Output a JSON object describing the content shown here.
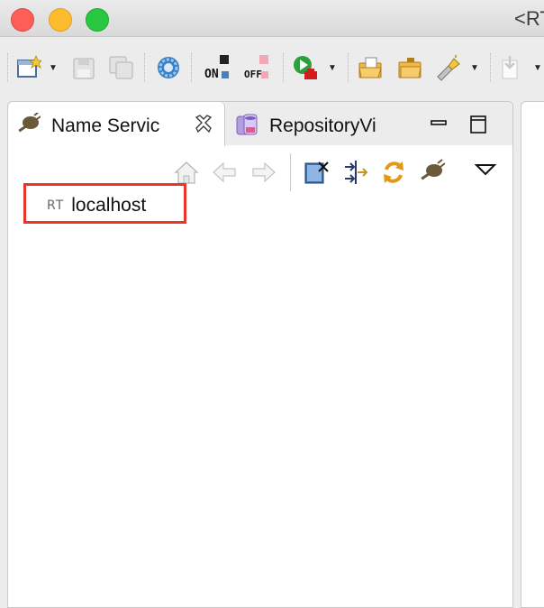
{
  "window": {
    "title": "<RT",
    "controls": [
      "close",
      "minimize",
      "zoom"
    ]
  },
  "toolbar": {
    "buttons": [
      {
        "icon": "new-icon"
      },
      {
        "icon": "save-icon"
      },
      {
        "icon": "save-all-icon"
      },
      {
        "icon": "settings-gear-icon"
      },
      {
        "icon": "on-icon"
      },
      {
        "icon": "off-icon"
      },
      {
        "icon": "run-icon"
      },
      {
        "icon": "open-folder-icon"
      },
      {
        "icon": "open-project-icon"
      },
      {
        "icon": "flashlight-icon"
      },
      {
        "icon": "import-icon"
      }
    ]
  },
  "panel": {
    "tabs": [
      {
        "label": "Name Servic",
        "icon": "plug-icon",
        "active": true
      },
      {
        "label": "RepositoryVi",
        "icon": "repository-icon",
        "active": false
      }
    ],
    "view_toolbar": [
      "home-icon",
      "back-icon",
      "forward-icon",
      "connect-icon",
      "sync-arrows-icon",
      "refresh-icon",
      "plug-icon",
      "view-menu-icon"
    ]
  },
  "tree": {
    "items": [
      {
        "icon_text": "RT",
        "label": "localhost"
      }
    ]
  },
  "colors": {
    "highlight": "#e8362b",
    "background": "#ececec"
  }
}
